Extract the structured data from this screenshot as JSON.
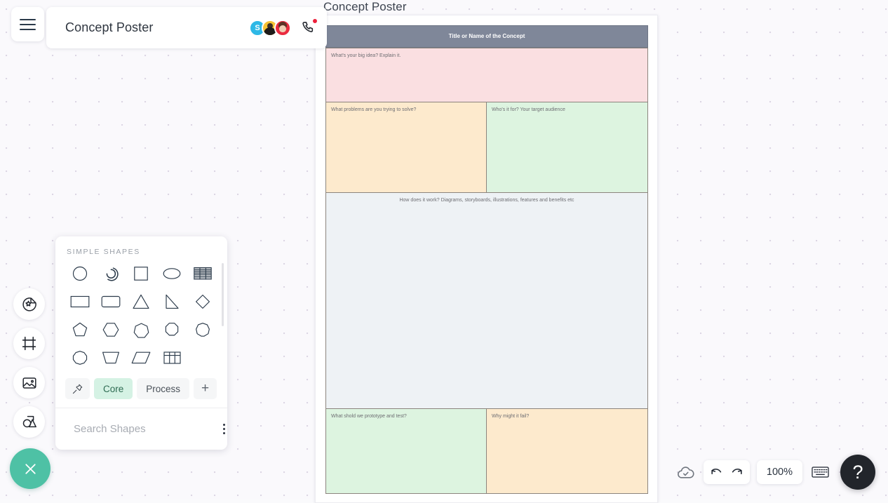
{
  "app": {
    "board_title": "Concept Poster",
    "menu_icon": "hamburger-menu-icon",
    "phone_icon": "phone-call-icon"
  },
  "collaborators": [
    {
      "name": "S",
      "type": "initial",
      "color": "#2eb8e6"
    },
    {
      "name": "",
      "type": "photo",
      "color": "#f5c234"
    },
    {
      "name": "",
      "type": "photo",
      "color": "#ea2b3f"
    }
  ],
  "rail": {
    "items": [
      {
        "icon": "sticker-badge-icon",
        "label": "Stickers"
      },
      {
        "icon": "frame-icon",
        "label": "Frames"
      },
      {
        "icon": "image-icon",
        "label": "Images"
      },
      {
        "icon": "shapes-icon",
        "label": "Shapes"
      }
    ],
    "close_icon": "close-icon"
  },
  "shapes_panel": {
    "header": "SIMPLE SHAPES",
    "shapes": [
      "circle",
      "arc",
      "square",
      "ellipse",
      "table-striped",
      "rectangle",
      "rounded-rectangle",
      "triangle",
      "right-triangle",
      "diamond",
      "pentagon",
      "hexagon",
      "heptagon",
      "octagon",
      "nonagon",
      "decagon",
      "trapezoid",
      "parallelogram",
      "table-grid"
    ],
    "tabs": [
      {
        "label": "",
        "icon": "pin-icon",
        "active": false
      },
      {
        "label": "Core",
        "icon": "",
        "active": true
      },
      {
        "label": "Process",
        "icon": "",
        "active": false
      },
      {
        "label": "+",
        "icon": "plus-icon",
        "active": false
      }
    ],
    "search_placeholder": "Search Shapes",
    "search_value": "",
    "search_icon": "search-icon",
    "menu_icon": "kebab-menu-icon"
  },
  "poster": {
    "canvas_title": "Concept Poster",
    "cells": [
      {
        "name": "title-header",
        "text": "Title or Name of the Concept",
        "bg": "#7f8799",
        "header": true
      },
      {
        "name": "big-idea",
        "text": "What's your big idea? Explain it.",
        "bg": "#fadfe1"
      },
      {
        "name": "problems",
        "text": "What problems are you trying to solve?",
        "bg": "#fdeacd"
      },
      {
        "name": "audience",
        "text": "Who's it for? Your target audience",
        "bg": "#ddf4e0"
      },
      {
        "name": "how-it-works",
        "text": "How does it work? Diagrams, storyboards, illustrations, features and benefits etc",
        "bg": "#eef2f5",
        "center": true
      },
      {
        "name": "prototype-test",
        "text": "What shold we prototype and test?",
        "bg": "#ddf4e0"
      },
      {
        "name": "why-fail",
        "text": "Why might it fail?",
        "bg": "#fdeacd"
      }
    ]
  },
  "bottom_toolbar": {
    "cloud_icon": "cloud-saved-icon",
    "undo_icon": "undo-icon",
    "redo_icon": "redo-icon",
    "zoom_level": "100%",
    "keyboard_icon": "keyboard-icon",
    "help_label": "?"
  }
}
